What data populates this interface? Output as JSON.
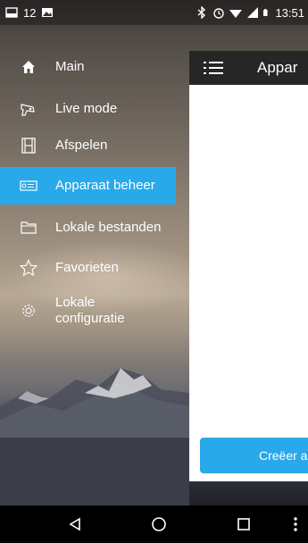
{
  "status_bar": {
    "notification_count": "12",
    "time": "13:51"
  },
  "drawer": {
    "items": [
      {
        "label": "Main",
        "icon": "home-icon"
      },
      {
        "label": "Live mode",
        "icon": "camera-icon"
      },
      {
        "label": "Afspelen",
        "icon": "film-icon"
      },
      {
        "label": "Apparaat beheer",
        "icon": "device-manager-icon",
        "active": true
      },
      {
        "label": "Lokale bestanden",
        "icon": "folder-icon"
      },
      {
        "label": "Favorieten",
        "icon": "star-icon"
      },
      {
        "label": "Lokale\nconfiguratie",
        "icon": "gear-icon"
      }
    ]
  },
  "panel": {
    "title": "Appar",
    "create_button": "Creëer a"
  },
  "colors": {
    "accent": "#29a8ea",
    "panel_header": "#262626"
  }
}
